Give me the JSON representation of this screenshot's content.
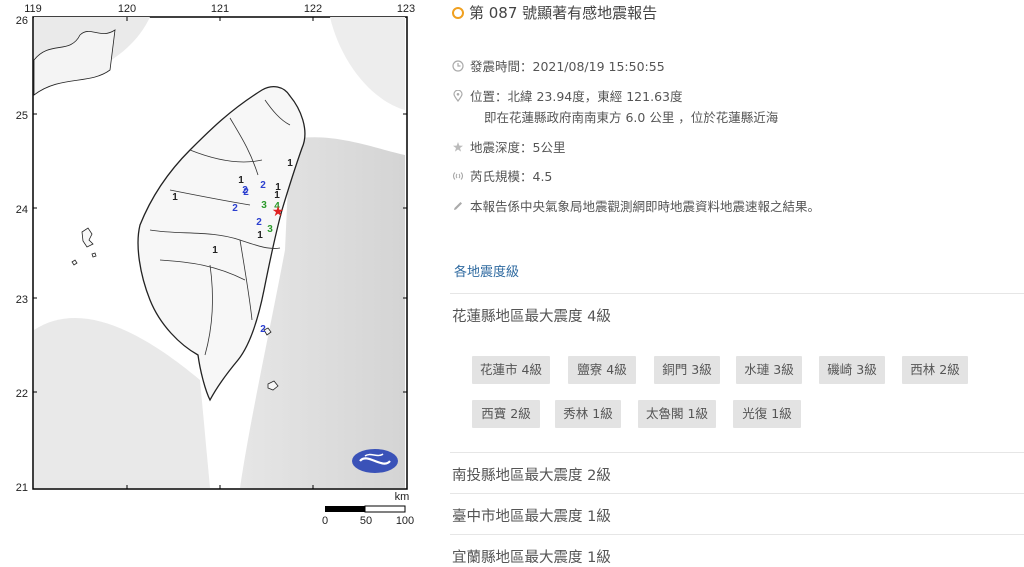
{
  "map": {
    "lon_labels": [
      "119",
      "120",
      "121",
      "122",
      "123"
    ],
    "lat_labels": [
      "26",
      "25",
      "24",
      "23",
      "22",
      "21"
    ],
    "scale": {
      "unit": "km",
      "ticks": [
        "0",
        "50",
        "100"
      ]
    },
    "intensity_marks": [
      {
        "v": "1",
        "c": "#222"
      },
      {
        "v": "2",
        "c": "#2b3fcf"
      },
      {
        "v": "1",
        "c": "#222"
      },
      {
        "v": "2",
        "c": "#2b3fcf"
      },
      {
        "v": "1",
        "c": "#222"
      },
      {
        "v": "2",
        "c": "#2b3fcf"
      },
      {
        "v": "1",
        "c": "#222"
      },
      {
        "v": "3",
        "c": "#2a9a2a"
      },
      {
        "v": "4",
        "c": "#2a9a2a"
      },
      {
        "v": "2",
        "c": "#2b3fcf"
      },
      {
        "v": "1",
        "c": "#222"
      },
      {
        "v": "3",
        "c": "#2a9a2a"
      },
      {
        "v": "1",
        "c": "#222"
      },
      {
        "v": "2",
        "c": "#2b3fcf"
      },
      {
        "v": "1",
        "c": "#222"
      },
      {
        "v": "2",
        "c": "#2b3fcf"
      }
    ],
    "epicenter_color": "#e02020",
    "logo_color": "#3a52b8"
  },
  "report": {
    "title": "第 087 號顯著有感地震報告",
    "time": "發震時間：2021/08/19 15:50:55",
    "location": "位置：北緯 23.94度，東經 121.63度",
    "location_detail": "即在花蓮縣政府南南東方 6.0 公里 ，位於花蓮縣近海",
    "depth": "地震深度：5公里",
    "magnitude": "芮氏規模：4.5",
    "note": "本報告係中央氣象局地震觀測網即時地震資料地震速報之結果。",
    "section_link": "各地震度級",
    "regions": [
      "花蓮縣地區最大震度 4級",
      "南投縣地區最大震度 2級",
      "臺中市地區最大震度 1級",
      "宜蘭縣地區最大震度 1級"
    ],
    "stations": [
      "花蓮市 4級",
      "鹽寮 4級",
      "銅門 3級",
      "水璉 3級",
      "磯崎 3級",
      "西林 2級",
      "西寶 2級",
      "秀林 1級",
      "太魯閣 1級",
      "光復 1級"
    ]
  }
}
